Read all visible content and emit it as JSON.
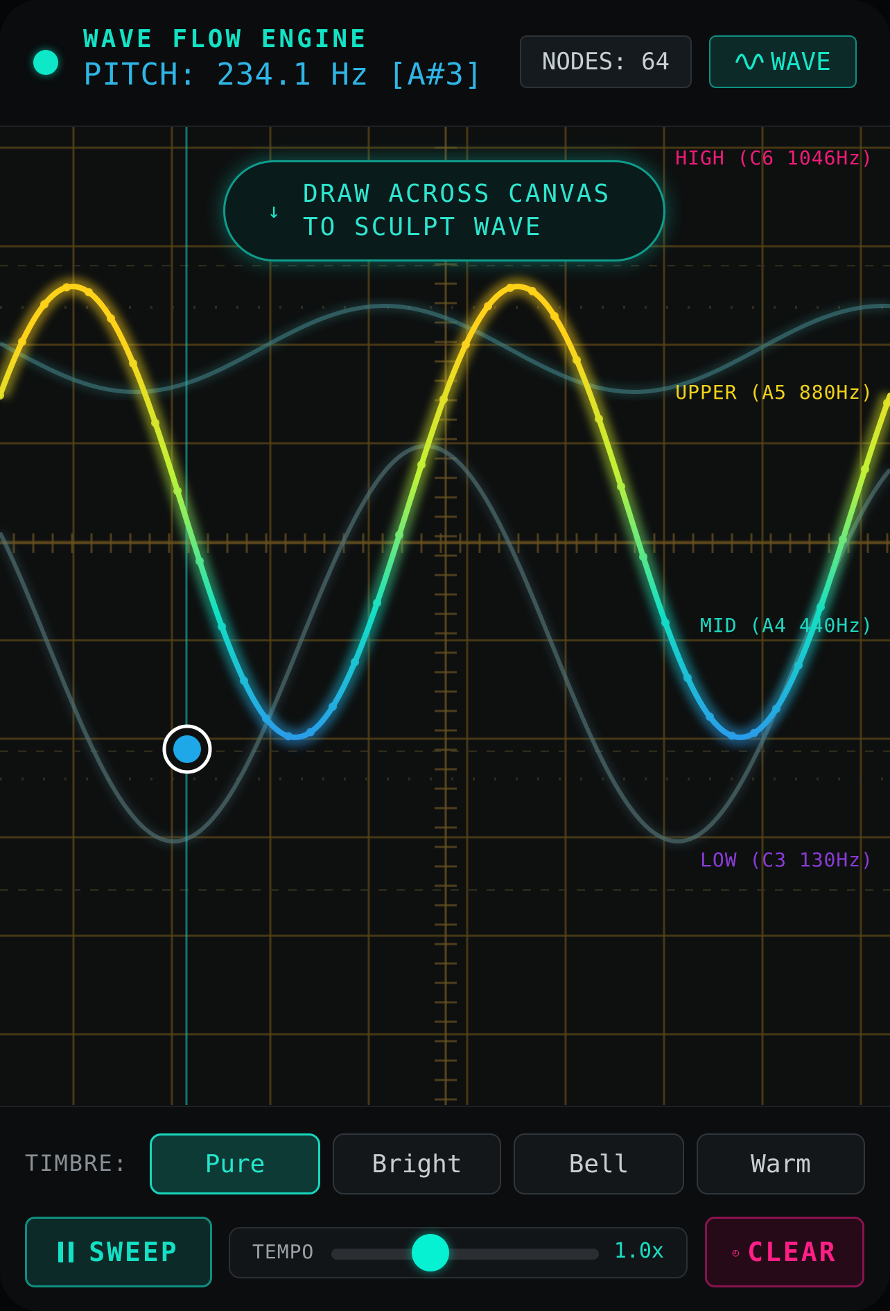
{
  "header": {
    "title": "WAVE FLOW ENGINE",
    "pitch": "PITCH: 234.1 Hz [A#3]",
    "nodes": "NODES: 64",
    "mode_button": "WAVE",
    "status_color": "#0ee8c8"
  },
  "canvas": {
    "hint": {
      "line1": "DRAW ACROSS CANVAS",
      "line2": "TO SCULPT WAVE"
    },
    "bands": [
      {
        "label": "HIGH (C6 1046Hz)",
        "color": "#f01c78"
      },
      {
        "label": "UPPER (A5 880Hz)",
        "color": "#f2d21a"
      },
      {
        "label": "MID (A4 440Hz)",
        "color": "#1fd8c0"
      },
      {
        "label": "LOW (C3 130Hz)",
        "color": "#8a3bd6"
      }
    ],
    "wave_gradient": {
      "top": "#ffd21a",
      "mid": "#12e0c4",
      "bottom": "#3a63f5"
    }
  },
  "controls": {
    "timbre_label": "TIMBRE:",
    "timbres": [
      {
        "label": "Pure",
        "active": true
      },
      {
        "label": "Bright",
        "active": false
      },
      {
        "label": "Bell",
        "active": false
      },
      {
        "label": "Warm",
        "active": false
      }
    ],
    "sweep_label": "SWEEP",
    "tempo_label": "TEMPO",
    "tempo_value": "1.0x",
    "tempo_level": 0.37,
    "clear_label": "CLEAR"
  }
}
